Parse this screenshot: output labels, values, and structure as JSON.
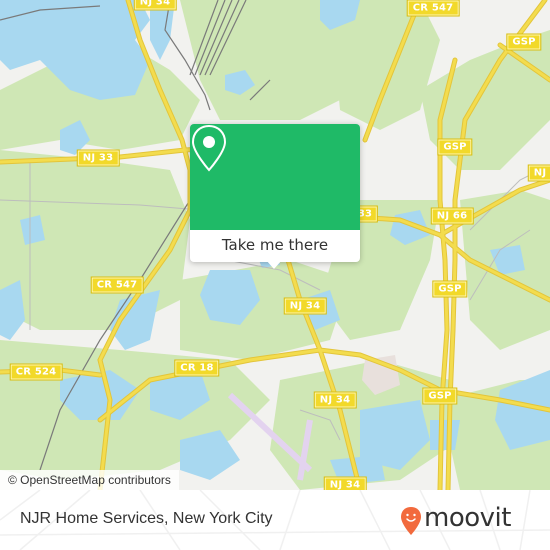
{
  "map": {
    "colors": {
      "land": "#f2f2ef",
      "forest": "#cfe7b5",
      "water": "#a8d8f0",
      "road": "#f3dc4e",
      "road_edge": "#e3c53a",
      "rail": "#7a7a7a",
      "airport": "#e3d3ef",
      "industrial": "#e8e0dc"
    },
    "road_labels": [
      {
        "id": "nj34-top",
        "text": "NJ 34"
      },
      {
        "id": "cr547-top",
        "text": "CR 547"
      },
      {
        "id": "gsp-top",
        "text": "GSP"
      },
      {
        "id": "nj33",
        "text": "NJ 33"
      },
      {
        "id": "gsp-mid",
        "text": "GSP"
      },
      {
        "id": "nj-right",
        "text": "NJ"
      },
      {
        "id": "nj33-right",
        "text": "33"
      },
      {
        "id": "nj66",
        "text": "NJ 66"
      },
      {
        "id": "cr547-left",
        "text": "CR 547"
      },
      {
        "id": "gsp-lower",
        "text": "GSP"
      },
      {
        "id": "nj34-mid",
        "text": "NJ 34"
      },
      {
        "id": "cr524",
        "text": "CR 524"
      },
      {
        "id": "cr18",
        "text": "CR 18"
      },
      {
        "id": "nj34-lower",
        "text": "NJ 34"
      },
      {
        "id": "gsp-bottom",
        "text": "GSP"
      },
      {
        "id": "nj34-bottom",
        "text": "NJ 34"
      }
    ],
    "attribution": "© OpenStreetMap contributors"
  },
  "popup": {
    "icon": "location-pin-icon",
    "accent": "#1fba67",
    "button_label": "Take me there"
  },
  "footer": {
    "place_name": "NJR Home Services, New York City",
    "logo_text": "moovit",
    "logo_icon": "moovit-smiley-pin-icon",
    "logo_color": "#f26a3d"
  }
}
